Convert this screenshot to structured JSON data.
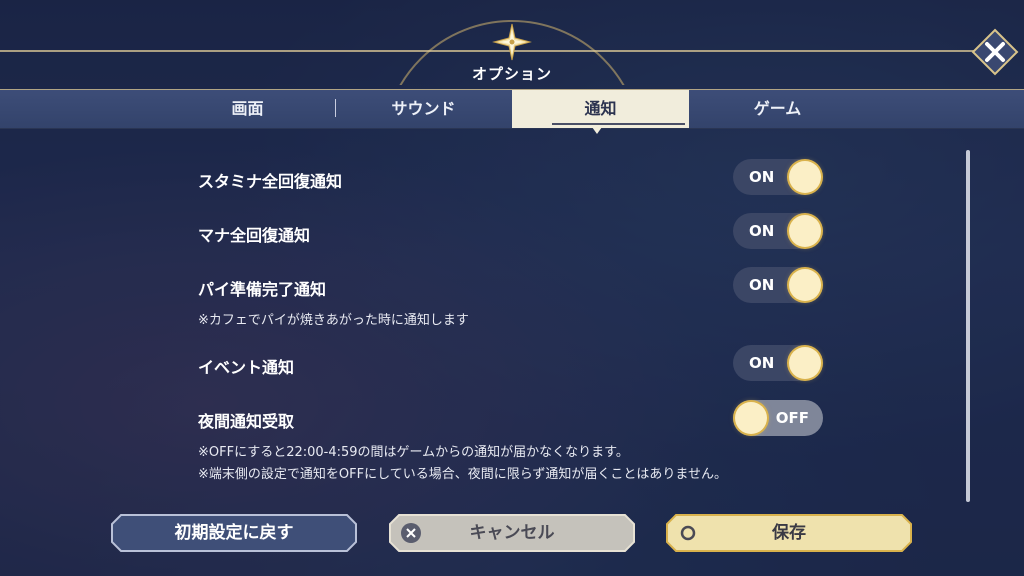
{
  "dialog": {
    "title": "オプション"
  },
  "tabs": [
    {
      "label": "画面",
      "active": false
    },
    {
      "label": "サウンド",
      "active": false
    },
    {
      "label": "通知",
      "active": true
    },
    {
      "label": "ゲーム",
      "active": false
    }
  ],
  "settings": [
    {
      "label": "スタミナ全回復通知",
      "state": "ON"
    },
    {
      "label": "マナ全回復通知",
      "state": "ON"
    },
    {
      "label": "パイ準備完了通知",
      "state": "ON",
      "note": "※カフェでパイが焼きあがった時に通知します"
    },
    {
      "label": "イベント通知",
      "state": "ON"
    },
    {
      "label": "夜間通知受取",
      "state": "OFF",
      "notes": [
        "※OFFにすると22:00-4:59の間はゲームからの通知が届かなくなります。",
        "※端末側の設定で通知をOFFにしている場合、夜間に限らず通知が届くことはありません。"
      ]
    }
  ],
  "buttons": {
    "reset": "初期設定に戻す",
    "cancel": "キャンセル",
    "save": "保存"
  },
  "colors": {
    "accent_gold": "#d9b24c",
    "active_tab": "#f1eddc",
    "toggle_on_track": "#3b4665",
    "toggle_off_track": "#7f8699"
  }
}
